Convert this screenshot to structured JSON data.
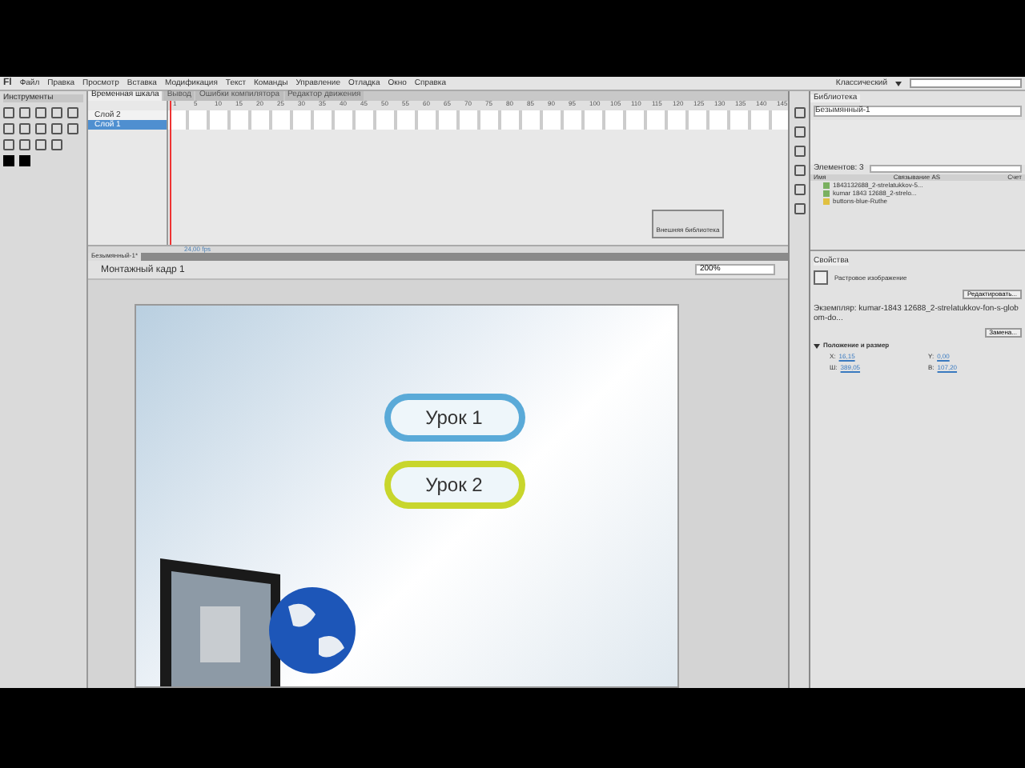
{
  "app_logo": "Fl",
  "menu": [
    "Файл",
    "Правка",
    "Просмотр",
    "Вставка",
    "Модификация",
    "Текст",
    "Команды",
    "Управление",
    "Отладка",
    "Окно",
    "Справка"
  ],
  "workspace": "Классический",
  "tools_title": "Инструменты",
  "timeline": {
    "tabs": [
      {
        "label": "Временная шкала",
        "selected": true
      },
      {
        "label": "Вывод",
        "selected": false
      },
      {
        "label": "Ошибки компилятора",
        "selected": false
      },
      {
        "label": "Редактор движения",
        "selected": false
      }
    ],
    "layers": [
      {
        "name": "Слой 2",
        "selected": false
      },
      {
        "name": "Слой 1",
        "selected": true
      }
    ],
    "frame_numbers": [
      "1",
      "5",
      "10",
      "15",
      "20",
      "25",
      "30",
      "35",
      "40",
      "45",
      "50",
      "55",
      "60",
      "65",
      "70",
      "75",
      "80",
      "85",
      "90",
      "95",
      "100",
      "105",
      "110",
      "115",
      "120",
      "125",
      "130",
      "135",
      "140",
      "145"
    ],
    "fps": "24,00 fps"
  },
  "floating_panel": {
    "button": "Внешняя библиотека"
  },
  "document": {
    "tab": "Безымянный-1*",
    "scene": "Монтажный кадр 1",
    "zoom": "200%",
    "buttons": [
      {
        "label": "Урок 1",
        "color": "#5aaad8"
      },
      {
        "label": "Урок 2",
        "color": "#c8d62c"
      }
    ]
  },
  "library": {
    "tab": "Библиотека",
    "document": "Безымянный-1",
    "count": "Элементов: 3",
    "columns": [
      "Имя",
      "Связывание AS",
      "Счет"
    ],
    "items": [
      {
        "kind": "bitmap",
        "name": "1843132688_2-strelatukkov-5..."
      },
      {
        "kind": "bitmap",
        "name": "kumar 1843 12688_2-strelo..."
      },
      {
        "kind": "folder",
        "name": "buttons-blue-Ruthe"
      }
    ]
  },
  "properties": {
    "tab": "Свойства",
    "type": "Растровое изображение",
    "edit_button": "Редактировать...",
    "instance": "Экземпляр: kumar-1843 12688_2-strelatukkov-fon-s-globom-do...",
    "swap_button": "Замена...",
    "section": "Положение и размер",
    "fields": [
      {
        "label": "X:",
        "value": "16,15"
      },
      {
        "label": "Y:",
        "value": "0,00"
      },
      {
        "label": "Ш:",
        "value": "389,05"
      },
      {
        "label": "В:",
        "value": "107,20"
      }
    ]
  }
}
